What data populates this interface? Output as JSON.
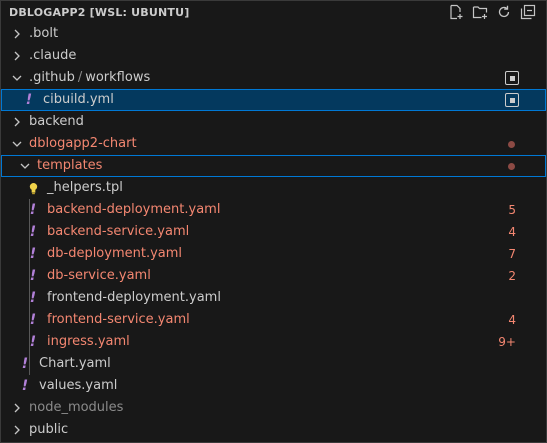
{
  "header": {
    "title": "DBLOGAPP2 [WSL: UBUNTU]",
    "actions": [
      "new-file-icon",
      "new-folder-icon",
      "refresh-icon",
      "collapse-all-icon"
    ]
  },
  "tree": {
    "bolt": ".bolt",
    "claude": ".claude",
    "github_a": ".github",
    "github_sep": "/",
    "github_b": "workflows",
    "cibuild": "cibuild.yml",
    "backend": "backend",
    "chart": "dblogapp2-chart",
    "templates": "templates",
    "helpers": "_helpers.tpl",
    "be_dep": "backend-deployment.yaml",
    "be_dep_badge": "5",
    "be_svc": "backend-service.yaml",
    "be_svc_badge": "4",
    "db_dep": "db-deployment.yaml",
    "db_dep_badge": "7",
    "db_svc": "db-service.yaml",
    "db_svc_badge": "2",
    "fe_dep": "frontend-deployment.yaml",
    "fe_svc": "frontend-service.yaml",
    "fe_svc_badge": "4",
    "ingress": "ingress.yaml",
    "ingress_badge": "9+",
    "chart_yaml": "Chart.yaml",
    "values_yaml": "values.yaml",
    "node_modules": "node_modules",
    "public": "public"
  },
  "colors": {
    "background": "#181818",
    "selected": "#04395e",
    "focus": "#0078d4",
    "error": "#f48771",
    "yaml_icon": "#b180d7",
    "bulb": "#f0d24a"
  }
}
